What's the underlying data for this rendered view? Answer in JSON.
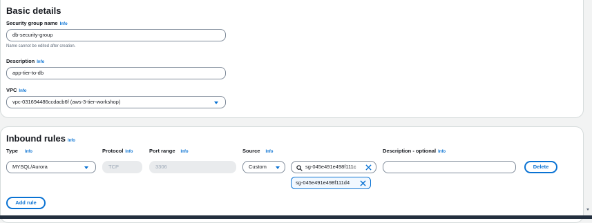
{
  "basic_details": {
    "heading": "Basic details",
    "sg_name_label": "Security group name",
    "info": "Info",
    "sg_name_value": "db-security-group",
    "sg_name_help": "Name cannot be edited after creation.",
    "description_label": "Description",
    "description_value": "app-tier-to-db",
    "vpc_label": "VPC",
    "vpc_value": "vpc-031694486ccdacb6f (aws-3-tier-workshop)"
  },
  "inbound_rules": {
    "heading": "Inbound rules",
    "info": "Info",
    "columns": {
      "type": "Type",
      "protocol": "Protocol",
      "port_range": "Port range",
      "source": "Source",
      "description": "Description - optional"
    },
    "rule": {
      "type": "MYSQL/Aurora",
      "protocol": "TCP",
      "port_range": "3306",
      "source_type": "Custom",
      "source_search": "sg-045e491e498f111c",
      "source_token": "sg-045e491e498f111d4",
      "description": ""
    },
    "delete_label": "Delete",
    "add_rule_label": "Add rule"
  }
}
